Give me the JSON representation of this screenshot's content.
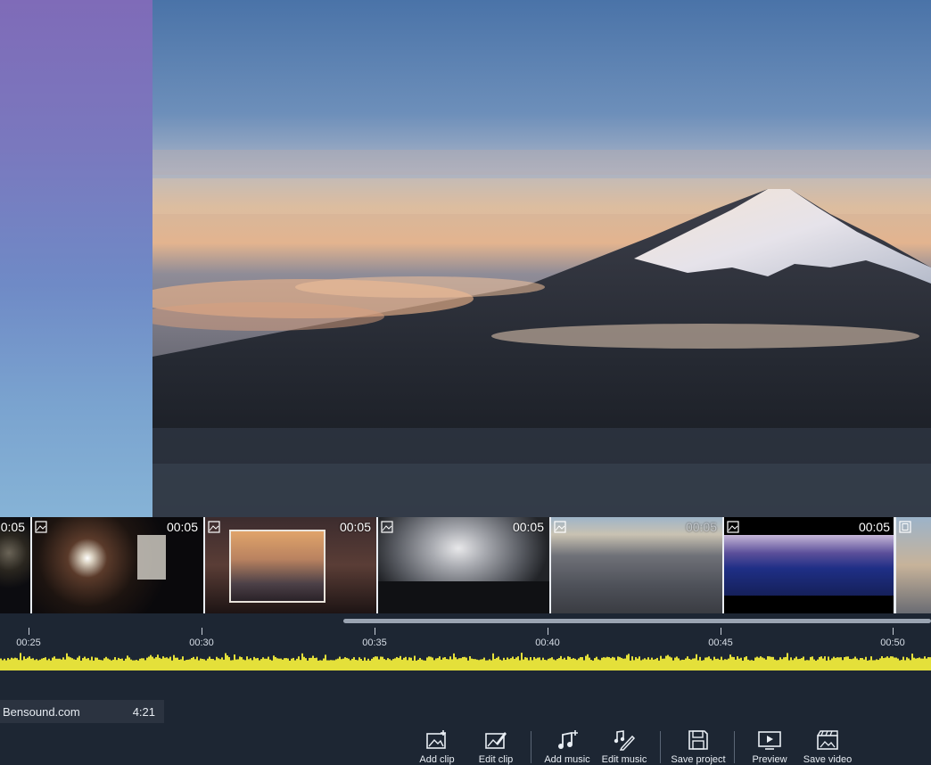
{
  "timeline": {
    "clips": [
      {
        "duration": "0:05",
        "icon": "image-icon"
      },
      {
        "duration": "00:05",
        "icon": "image-icon"
      },
      {
        "duration": "00:05",
        "icon": "image-icon"
      },
      {
        "duration": "00:05",
        "icon": "image-icon"
      },
      {
        "duration": "00:05",
        "icon": "image-icon"
      },
      {
        "duration": "00:05",
        "icon": "image-icon"
      },
      {
        "duration": "",
        "icon": "video-clip-icon"
      }
    ],
    "ruler_labels": [
      "00:25",
      "00:30",
      "00:35",
      "00:40",
      "00:45",
      "00:50"
    ]
  },
  "audio_track": {
    "name": "Bensound.com",
    "length": "4:21",
    "waveform_color": "#e4e03a"
  },
  "toolbar": {
    "buttons": [
      {
        "label": "Add clip",
        "icon": "add-clip-icon"
      },
      {
        "label": "Edit clip",
        "icon": "edit-clip-icon"
      },
      {
        "label": "Add music",
        "icon": "add-music-icon"
      },
      {
        "label": "Edit music",
        "icon": "edit-music-icon"
      },
      {
        "label": "Save project",
        "icon": "save-project-icon"
      },
      {
        "label": "Preview",
        "icon": "preview-icon"
      },
      {
        "label": "Save video",
        "icon": "save-video-icon"
      }
    ]
  },
  "colors": {
    "background": "#1d2633",
    "accent_waveform": "#e4e03a"
  }
}
